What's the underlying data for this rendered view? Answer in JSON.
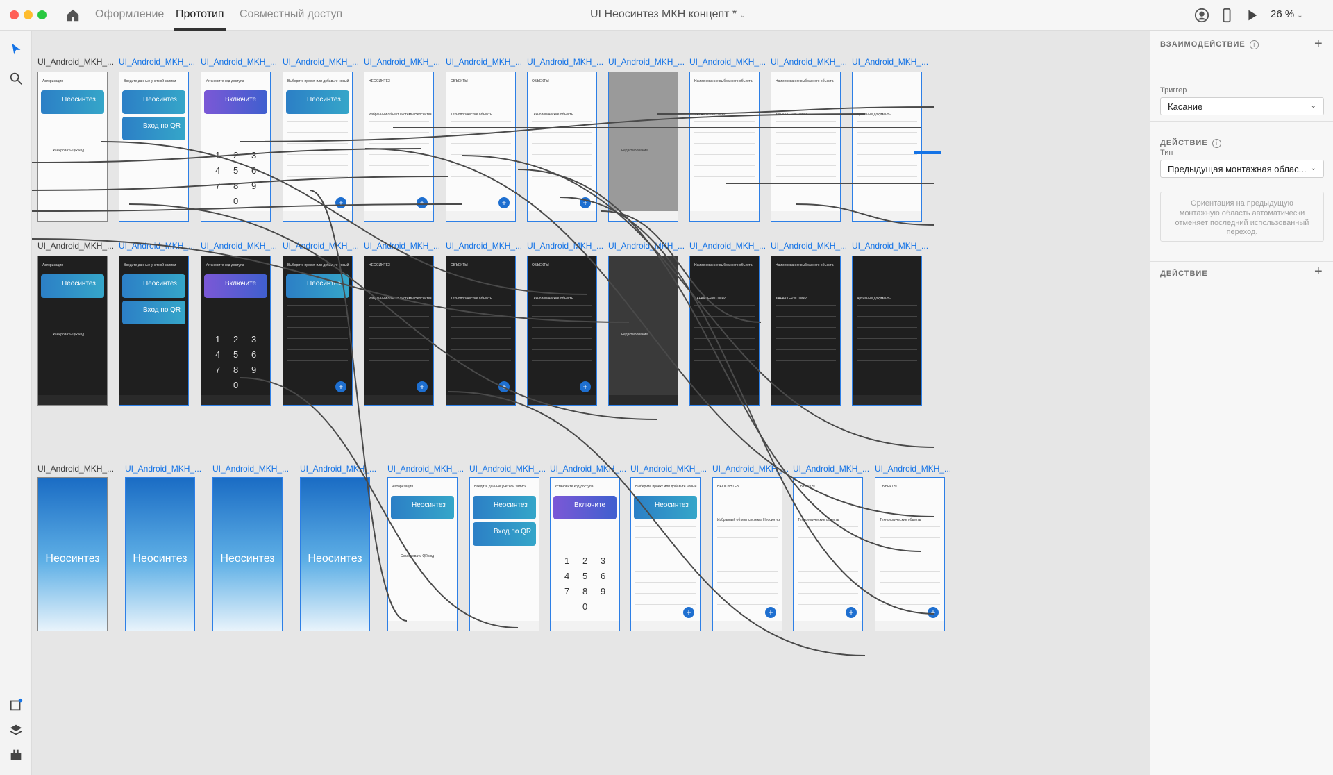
{
  "window": {
    "title": "UI Неосинтез МКН концепт *",
    "zoom": "26 %",
    "traffic_colors": [
      "#ff5f57",
      "#febc2e",
      "#28c840"
    ]
  },
  "mode_tabs": [
    {
      "label": "Оформление",
      "active": false
    },
    {
      "label": "Прототип",
      "active": true
    },
    {
      "label": "Совместный доступ",
      "active": false
    }
  ],
  "accent": "#1473e6",
  "canvas": {
    "artboard_label": "UI_Android_MKH_...",
    "row1": [
      {
        "kind": "auth",
        "title": "Авторизация",
        "card": "Неосинтез",
        "caption": "Сканировать QR код"
      },
      {
        "kind": "login",
        "title": "Введите данные учетной записи",
        "card": "Неосинтез",
        "card2": "Вход по QR"
      },
      {
        "kind": "pin",
        "title": "Установите код доступа",
        "card": "Включите"
      },
      {
        "kind": "projects",
        "title": "Выберите проект или добавьте новый",
        "card": "Неосинтез"
      },
      {
        "kind": "home",
        "title": "НЕОСИНТЕЗ",
        "caption": "Избранный объект системы Неосинтез"
      },
      {
        "kind": "objects",
        "title": "ОБЪЕКТЫ",
        "caption": "Технологические объекты"
      },
      {
        "kind": "objects",
        "title": "ОБЪЕКТЫ",
        "caption": "Технологические объекты"
      },
      {
        "kind": "menu",
        "title": "",
        "caption": "Редактирование"
      },
      {
        "kind": "detail",
        "title": "Наименование выбранного объекта",
        "caption": "ХАРАКТЕРИСТИКИ"
      },
      {
        "kind": "detail",
        "title": "Наименование выбранного объекта",
        "caption": "ХАРАКТЕРИСТИКИ"
      },
      {
        "kind": "list",
        "title": "",
        "caption": "Архивные документы"
      }
    ],
    "row3": [
      {
        "kind": "splash",
        "brand": "Неосинтез"
      },
      {
        "kind": "splash",
        "brand": "Неосинтез"
      },
      {
        "kind": "splash",
        "brand": "Неосинтез"
      },
      {
        "kind": "splash",
        "brand": "Неосинтез"
      },
      {
        "kind": "auth",
        "title": "Авторизация",
        "card": "Неосинтез",
        "caption": "Сканировать QR код"
      },
      {
        "kind": "login",
        "title": "Введите данные учетной записи",
        "card": "Неосинтез",
        "card2": "Вход по QR"
      },
      {
        "kind": "pin",
        "title": "Установите код доступа",
        "card": "Включите"
      },
      {
        "kind": "projects",
        "title": "Выберите проект или добавьте новый",
        "card": "Неосинтез"
      },
      {
        "kind": "home",
        "title": "НЕОСИНТЕЗ",
        "caption": "Избранный объект системы Неосинтез"
      },
      {
        "kind": "objects",
        "title": "ОБЪЕКТЫ",
        "caption": "Технологические объекты"
      },
      {
        "kind": "objects",
        "title": "ОБЪЕКТЫ",
        "caption": "Технологические объекты"
      }
    ],
    "pin_digits": [
      "1",
      "2",
      "3",
      "4",
      "5",
      "6",
      "7",
      "8",
      "9",
      "0"
    ]
  },
  "right_panel": {
    "interaction_header": "ВЗАИМОДЕЙСТВИЕ",
    "trigger_label": "Триггер",
    "trigger_value": "Касание",
    "action_header": "ДЕЙСТВИЕ",
    "type_label": "Тип",
    "type_value": "Предыдущая монтажная облас...",
    "note": "Ориентация на предыдущую монтажную область автоматически отменяет последний использованный переход.",
    "action_header2": "ДЕЙСТВИЕ"
  }
}
